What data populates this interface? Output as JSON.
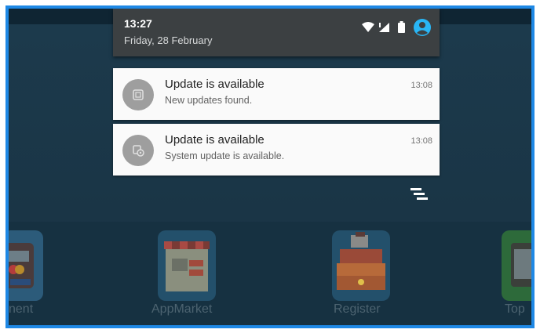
{
  "status_bar": {
    "time": "13:27",
    "date": "Friday, 28 February",
    "icons": [
      "wifi-icon",
      "signal-icon",
      "battery-icon",
      "account-icon"
    ]
  },
  "notifications": [
    {
      "icon": "app-update-icon",
      "title": "Update is available",
      "body": "New updates found.",
      "time": "13:08"
    },
    {
      "icon": "system-update-icon",
      "title": "Update is available",
      "body": "System update is available.",
      "time": "13:08"
    }
  ],
  "clear_all_icon": "clear-all-icon",
  "apps": [
    {
      "label": "nent",
      "icon": "payment-icon"
    },
    {
      "label": "AppMarket",
      "icon": "appmarket-icon"
    },
    {
      "label": "Register",
      "icon": "register-icon"
    },
    {
      "label": "Top",
      "icon": "topup-icon"
    }
  ],
  "colors": {
    "frame": "#1e88e5",
    "header": "#3c4042",
    "card": "#fafafa",
    "accent_account": "#29b6f6"
  }
}
